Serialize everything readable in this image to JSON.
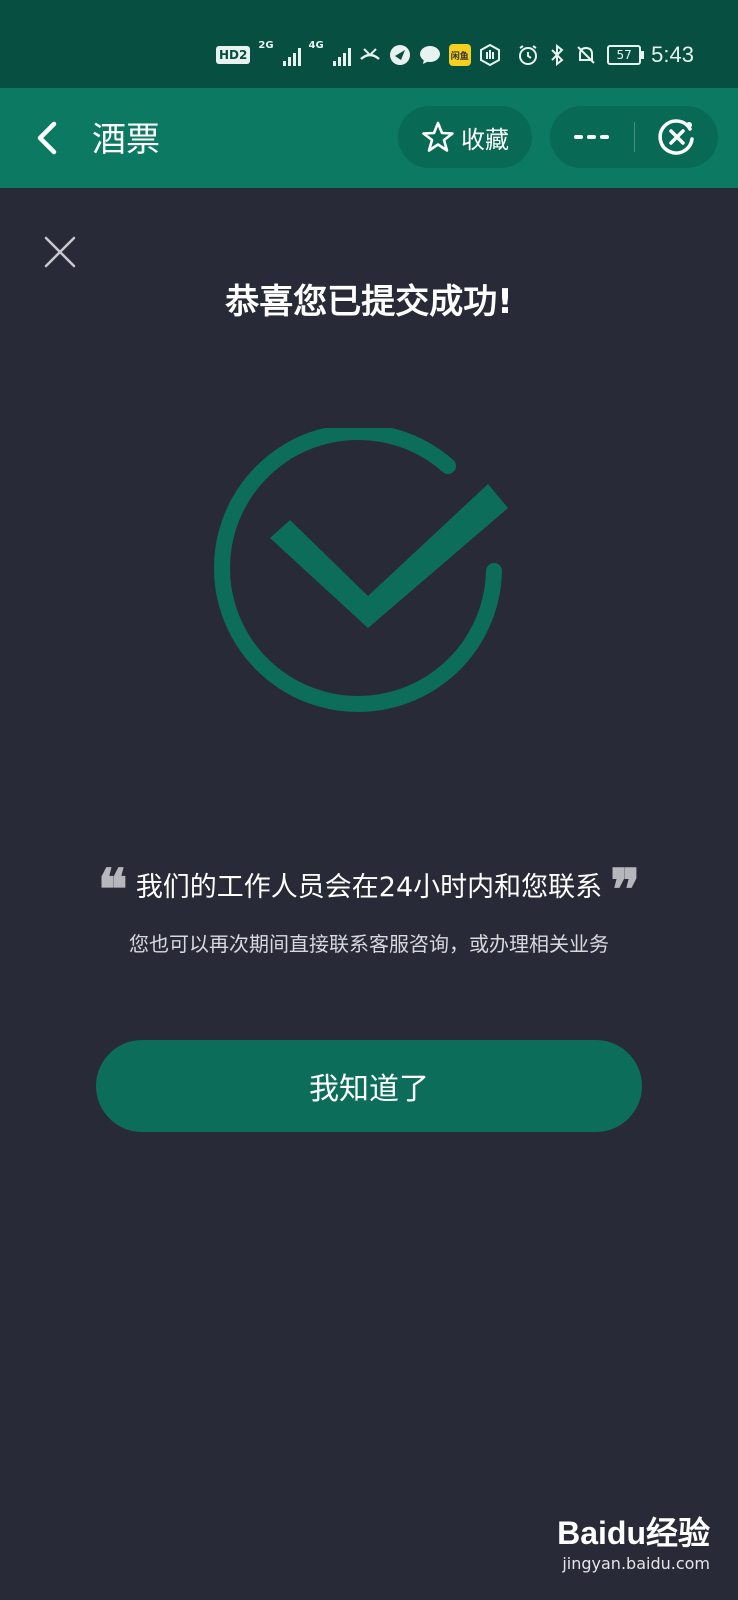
{
  "status_bar": {
    "hd_label": "HD",
    "hd_sub": "2",
    "net1": "2G",
    "net2": "4G",
    "app_icon_label": "闲鱼",
    "battery": "57",
    "time": "5:43"
  },
  "nav": {
    "title": "酒票",
    "favorite_label": "收藏"
  },
  "content": {
    "title": "恭喜您已提交成功!",
    "quote_open": "❝",
    "quote_close": "❞",
    "message": "我们的工作人员会在24小时内和您联系",
    "sub_message": "您也可以再次期间直接联系客服咨询，或办理相关业务",
    "button_label": "我知道了"
  },
  "watermark": {
    "logo": "Baidu经验",
    "url": "jingyan.baidu.com"
  },
  "colors": {
    "status_bar_bg": "#064f41",
    "nav_bar_bg": "#0c7a62",
    "page_bg": "#282a37",
    "accent_green": "#0c6e5a"
  }
}
